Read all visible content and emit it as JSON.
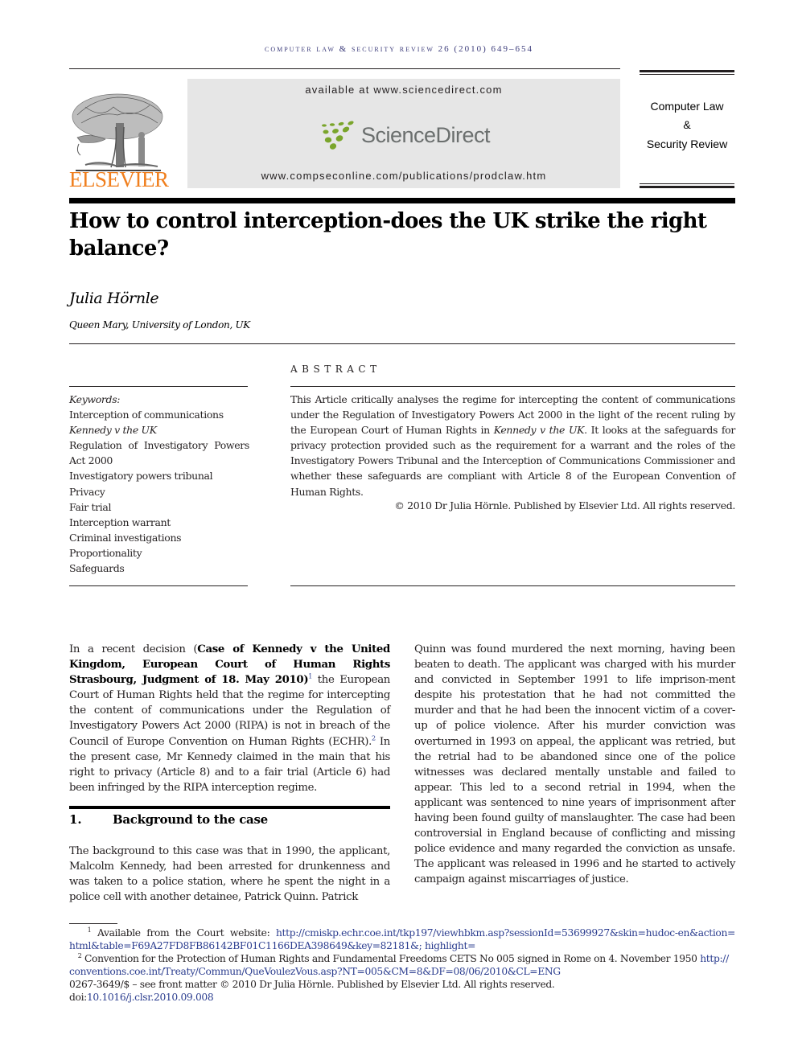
{
  "running_head": "COMPUTER LAW & SECURITY REVIEW 26 (2010) 649–654",
  "masthead": {
    "publisher": "ELSEVIER",
    "available_at": "available at www.sciencedirect.com",
    "sciencedirect_label": "ScienceDirect",
    "journal_url": "www.compseconline.com/publications/prodclaw.htm",
    "journal_name_lines": [
      "Computer Law",
      "&",
      "Security Review"
    ],
    "colors": {
      "elsevier_orange": "#f07f1e",
      "sciencedirect_green": "#7aa52b",
      "sciencedirect_gray": "#6b6f6e",
      "box_gray": "#e6e6e6"
    }
  },
  "article": {
    "title_line1": "How to control interception-does the UK strike the right",
    "title_line2": "balance?",
    "author": "Julia Hörnle",
    "affiliation": "Queen Mary, University of London, UK"
  },
  "keywords": {
    "heading": "Keywords:",
    "items": [
      "Interception of communications",
      "Kennedy v the UK",
      "Regulation of Investigatory Powers",
      "Act 2000",
      "Investigatory powers tribunal",
      "Privacy",
      "Fair trial",
      "Interception warrant",
      "Criminal investigations",
      "Proportionality",
      "Safeguards"
    ]
  },
  "abstract": {
    "heading": "ABSTRACT",
    "text_part1": "This Article critically analyses the regime for intercepting the content of communications under the Regulation of Investigatory Powers Act 2000 in the light of the recent ruling by the European Court of Human Rights in ",
    "text_italic": "Kennedy v the UK",
    "text_part2": ". It looks at the safeguards for privacy protection provided such as the requirement for a warrant and the roles of the Investigatory Powers Tribunal and the Interception of Communications Commissioner and whether these safeguards are compliant with Article 8 of the European Convention of Human Rights.",
    "copyright": "© 2010 Dr Julia Hörnle. Published by Elsevier Ltd. All rights reserved."
  },
  "body": {
    "intro_p1_a": "In a recent decision (",
    "intro_p1_bold": "Case of Kennedy v the United Kingdom, European Court of Human Rights Strasbourg, Judgment of 18. May 2010)",
    "intro_fn1": "1",
    "intro_p1_b": " the European Court of Human Rights held that the regime for intercepting the content of communications under the Regulation of Investigatory Powers Act 2000 (RIPA) is not in breach of the Council of Europe Convention on Human Rights (ECHR).",
    "intro_fn2": "2",
    "intro_p1_c": " In the present case, Mr Kennedy claimed in the main that his right to privacy (Article 8) and to a fair trial (Article 6) had been infringed by the RIPA interception regime.",
    "section1_number": "1.",
    "section1_title": "Background to the case",
    "section1_p1": "The background to this case was that in 1990, the applicant, Malcolm Kennedy, had been arrested for drunkenness and was taken to a police station, where he spent the night in a police cell with another detainee, Patrick Quinn. Patrick",
    "right_col_p1": "Quinn was found murdered the next morning, having been beaten to death. The applicant was charged with his murder and convicted in September 1991 to life imprison-ment despite his protestation that he had not committed the murder and that he had been the innocent victim of a cover-up of police violence. After his murder conviction was overturned in 1993 on appeal, the applicant was retried, but the retrial had to be abandoned since one of the police witnesses was declared mentally unstable and failed to appear. This led to a second retrial in 1994, when the applicant was sentenced to nine years of imprisonment after having been found guilty of manslaughter. The case had been controversial in England because of conflicting and missing police evidence and many regarded the conviction as unsafe. The applicant was released in 1996 and he started to actively campaign against miscarriages of justice."
  },
  "footnotes": {
    "fn1_num": "1",
    "fn1_text": "Available from the Court website: ",
    "fn1_link_a": "http://cmiskp.echr.coe.int/tkp197/viewhbkm.asp?sessionId=53699927&skin=hudoc-en&action=",
    "fn1_link_b": "html&table=F69A27FD8FB86142BF01C1166DEA398649&key=82181&; highlight=",
    "fn2_num": "2",
    "fn2_text": "Convention for the Protection of Human Rights and Fundamental Freedoms CETS No 005 signed in Rome on 4. November 1950 ",
    "fn2_link_a": "http://",
    "fn2_link_b": "conventions.coe.int/Treaty/Commun/QueVoulezVous.asp?NT=005&CM=8&DF=08/06/2010&CL=ENG",
    "front_matter": "0267-3649/$ – see front matter © 2010 Dr Julia Hörnle. Published by Elsevier Ltd. All rights reserved.",
    "doi_prefix": "doi:",
    "doi": "10.1016/j.clsr.2010.09.008"
  }
}
